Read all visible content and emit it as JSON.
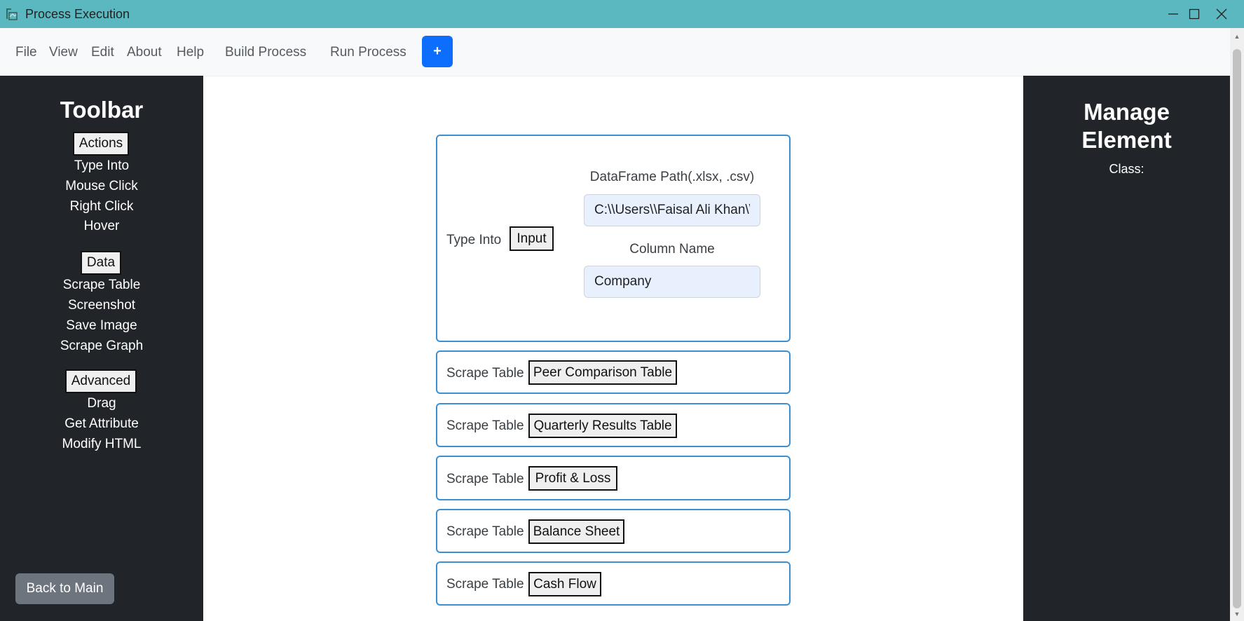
{
  "window": {
    "title": "Process Execution",
    "title_bar_color": "#5bb8c1"
  },
  "menubar": {
    "items": [
      "File",
      "View",
      "Edit",
      "About",
      "Help",
      "Build Process",
      "Run Process"
    ],
    "add_label": "+",
    "add_color": "#0d6efd"
  },
  "toolbar": {
    "title": "Toolbar",
    "groups": [
      {
        "label": "Actions",
        "items": [
          "Type Into",
          "Mouse Click",
          "Right Click",
          "Hover"
        ]
      },
      {
        "label": "Data",
        "items": [
          "Scrape Table",
          "Screenshot",
          "Save Image",
          "Scrape Graph"
        ]
      },
      {
        "label": "Advanced",
        "items": [
          "Drag",
          "Get Attribute",
          "Modify HTML"
        ]
      }
    ],
    "back_label": "Back to Main"
  },
  "manage": {
    "title_line1": "Manage",
    "title_line2": "Element",
    "class_label": "Class:"
  },
  "steps": {
    "type_into": {
      "label": "Type Into",
      "button": "Input",
      "path_label": "DataFrame Path(.xlsx, .csv)",
      "path_value": "C:\\\\Users\\\\Faisal Ali Khan\\\\",
      "column_label": "Column Name",
      "column_value": "Company"
    },
    "scrape": [
      {
        "label": "Scrape Table",
        "button": "Peer Comparison Table"
      },
      {
        "label": "Scrape Table",
        "button": "Quarterly Results Table"
      },
      {
        "label": "Scrape Table",
        "button": "Profit & Loss"
      },
      {
        "label": "Scrape Table",
        "button": "Balance Sheet"
      },
      {
        "label": "Scrape Table",
        "button": "Cash Flow"
      }
    ]
  },
  "colors": {
    "sidebar_bg": "#212529",
    "card_border": "#3c8fd0",
    "input_bg": "#e8f0fe",
    "back_button": "#6c757d"
  },
  "icons": [
    "app-icon",
    "minimize-icon",
    "maximize-icon",
    "close-icon",
    "scroll-up-icon",
    "scroll-down-icon"
  ]
}
